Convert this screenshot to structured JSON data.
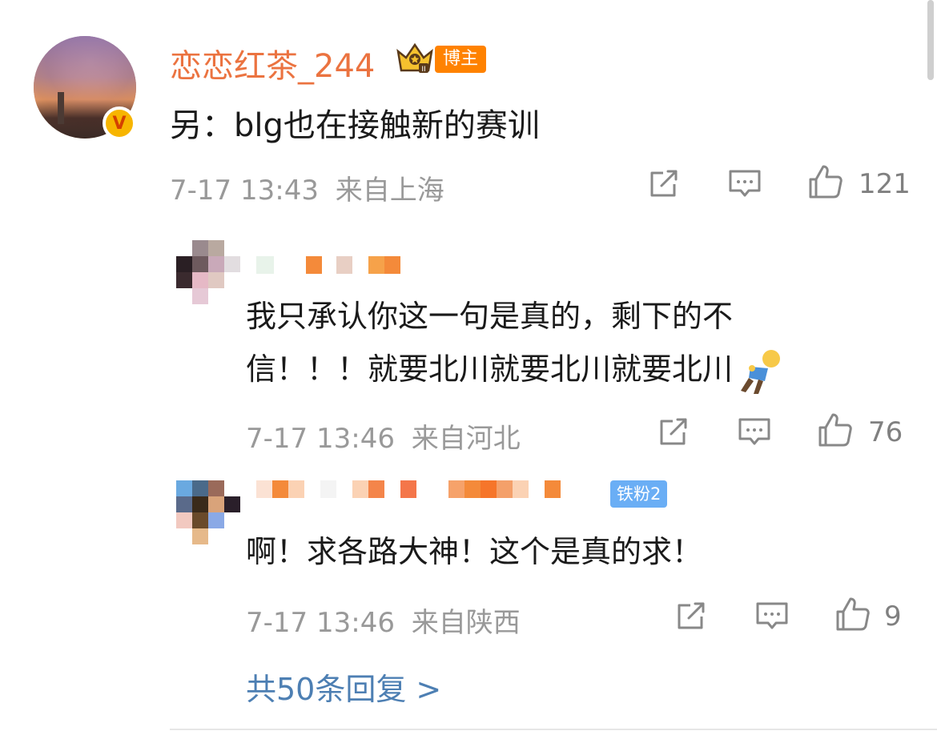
{
  "main_comment": {
    "username": "恋恋红茶_244",
    "badge": "博主",
    "verified_mark": "V",
    "text": "另：blg也在接触新的赛训",
    "time": "7-17 13:43",
    "location": "来自上海",
    "likes": "121"
  },
  "replies": [
    {
      "text_line1": "我只承认你这一句是真的，剩下的不",
      "text_line2": "信！！！就要北川就要北川就要北川",
      "emoji": "kneeling-man-emoji",
      "time": "7-17 13:46",
      "location": "来自河北",
      "likes": "76"
    },
    {
      "fan_badge": "铁粉2",
      "text": "啊！求各路大神！这个是真的求！",
      "time": "7-17 13:46",
      "location": "来自陕西",
      "likes": "9"
    }
  ],
  "more_replies_label": "共50条回复 >",
  "icons": {
    "share": "share-icon",
    "comment": "comment-icon",
    "like": "thumbs-up-icon",
    "crown": "crown-icon"
  },
  "colors": {
    "username": "#eb7340",
    "badge_orange": "#ff8200",
    "fan_badge": "#6aaef5",
    "link_blue": "#4d7fb3",
    "meta_gray": "#999999"
  }
}
